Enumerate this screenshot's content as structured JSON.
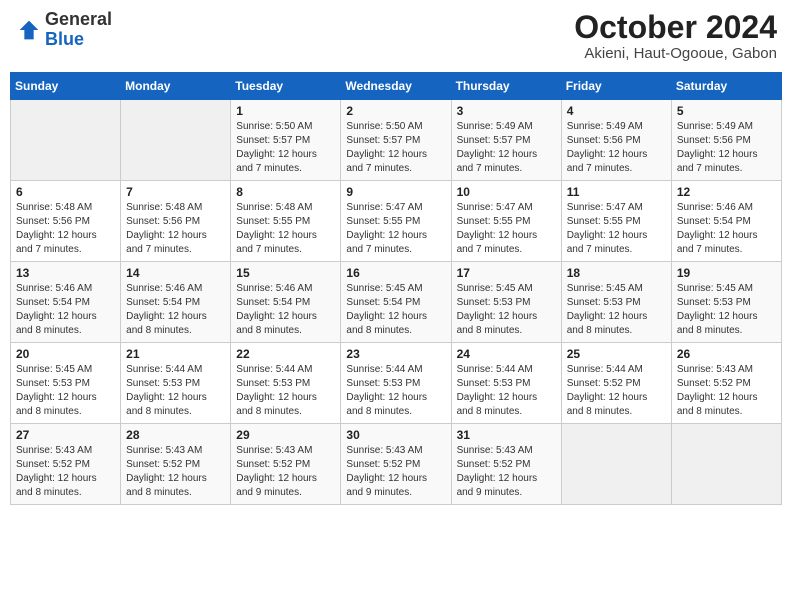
{
  "header": {
    "logo_general": "General",
    "logo_blue": "Blue",
    "title": "October 2024",
    "subtitle": "Akieni, Haut-Ogooue, Gabon"
  },
  "days_of_week": [
    "Sunday",
    "Monday",
    "Tuesday",
    "Wednesday",
    "Thursday",
    "Friday",
    "Saturday"
  ],
  "weeks": [
    [
      {
        "day": "",
        "info": ""
      },
      {
        "day": "",
        "info": ""
      },
      {
        "day": "1",
        "info": "Sunrise: 5:50 AM\nSunset: 5:57 PM\nDaylight: 12 hours\nand 7 minutes."
      },
      {
        "day": "2",
        "info": "Sunrise: 5:50 AM\nSunset: 5:57 PM\nDaylight: 12 hours\nand 7 minutes."
      },
      {
        "day": "3",
        "info": "Sunrise: 5:49 AM\nSunset: 5:57 PM\nDaylight: 12 hours\nand 7 minutes."
      },
      {
        "day": "4",
        "info": "Sunrise: 5:49 AM\nSunset: 5:56 PM\nDaylight: 12 hours\nand 7 minutes."
      },
      {
        "day": "5",
        "info": "Sunrise: 5:49 AM\nSunset: 5:56 PM\nDaylight: 12 hours\nand 7 minutes."
      }
    ],
    [
      {
        "day": "6",
        "info": "Sunrise: 5:48 AM\nSunset: 5:56 PM\nDaylight: 12 hours\nand 7 minutes."
      },
      {
        "day": "7",
        "info": "Sunrise: 5:48 AM\nSunset: 5:56 PM\nDaylight: 12 hours\nand 7 minutes."
      },
      {
        "day": "8",
        "info": "Sunrise: 5:48 AM\nSunset: 5:55 PM\nDaylight: 12 hours\nand 7 minutes."
      },
      {
        "day": "9",
        "info": "Sunrise: 5:47 AM\nSunset: 5:55 PM\nDaylight: 12 hours\nand 7 minutes."
      },
      {
        "day": "10",
        "info": "Sunrise: 5:47 AM\nSunset: 5:55 PM\nDaylight: 12 hours\nand 7 minutes."
      },
      {
        "day": "11",
        "info": "Sunrise: 5:47 AM\nSunset: 5:55 PM\nDaylight: 12 hours\nand 7 minutes."
      },
      {
        "day": "12",
        "info": "Sunrise: 5:46 AM\nSunset: 5:54 PM\nDaylight: 12 hours\nand 7 minutes."
      }
    ],
    [
      {
        "day": "13",
        "info": "Sunrise: 5:46 AM\nSunset: 5:54 PM\nDaylight: 12 hours\nand 8 minutes."
      },
      {
        "day": "14",
        "info": "Sunrise: 5:46 AM\nSunset: 5:54 PM\nDaylight: 12 hours\nand 8 minutes."
      },
      {
        "day": "15",
        "info": "Sunrise: 5:46 AM\nSunset: 5:54 PM\nDaylight: 12 hours\nand 8 minutes."
      },
      {
        "day": "16",
        "info": "Sunrise: 5:45 AM\nSunset: 5:54 PM\nDaylight: 12 hours\nand 8 minutes."
      },
      {
        "day": "17",
        "info": "Sunrise: 5:45 AM\nSunset: 5:53 PM\nDaylight: 12 hours\nand 8 minutes."
      },
      {
        "day": "18",
        "info": "Sunrise: 5:45 AM\nSunset: 5:53 PM\nDaylight: 12 hours\nand 8 minutes."
      },
      {
        "day": "19",
        "info": "Sunrise: 5:45 AM\nSunset: 5:53 PM\nDaylight: 12 hours\nand 8 minutes."
      }
    ],
    [
      {
        "day": "20",
        "info": "Sunrise: 5:45 AM\nSunset: 5:53 PM\nDaylight: 12 hours\nand 8 minutes."
      },
      {
        "day": "21",
        "info": "Sunrise: 5:44 AM\nSunset: 5:53 PM\nDaylight: 12 hours\nand 8 minutes."
      },
      {
        "day": "22",
        "info": "Sunrise: 5:44 AM\nSunset: 5:53 PM\nDaylight: 12 hours\nand 8 minutes."
      },
      {
        "day": "23",
        "info": "Sunrise: 5:44 AM\nSunset: 5:53 PM\nDaylight: 12 hours\nand 8 minutes."
      },
      {
        "day": "24",
        "info": "Sunrise: 5:44 AM\nSunset: 5:53 PM\nDaylight: 12 hours\nand 8 minutes."
      },
      {
        "day": "25",
        "info": "Sunrise: 5:44 AM\nSunset: 5:52 PM\nDaylight: 12 hours\nand 8 minutes."
      },
      {
        "day": "26",
        "info": "Sunrise: 5:43 AM\nSunset: 5:52 PM\nDaylight: 12 hours\nand 8 minutes."
      }
    ],
    [
      {
        "day": "27",
        "info": "Sunrise: 5:43 AM\nSunset: 5:52 PM\nDaylight: 12 hours\nand 8 minutes."
      },
      {
        "day": "28",
        "info": "Sunrise: 5:43 AM\nSunset: 5:52 PM\nDaylight: 12 hours\nand 8 minutes."
      },
      {
        "day": "29",
        "info": "Sunrise: 5:43 AM\nSunset: 5:52 PM\nDaylight: 12 hours\nand 9 minutes."
      },
      {
        "day": "30",
        "info": "Sunrise: 5:43 AM\nSunset: 5:52 PM\nDaylight: 12 hours\nand 9 minutes."
      },
      {
        "day": "31",
        "info": "Sunrise: 5:43 AM\nSunset: 5:52 PM\nDaylight: 12 hours\nand 9 minutes."
      },
      {
        "day": "",
        "info": ""
      },
      {
        "day": "",
        "info": ""
      }
    ]
  ]
}
